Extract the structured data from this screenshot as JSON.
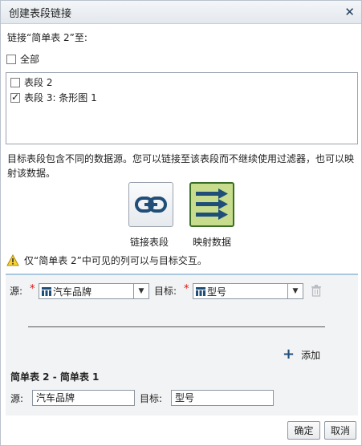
{
  "dialog": {
    "title": "创建表段链接"
  },
  "link_prompt": "链接“简单表 2”至:",
  "select_all": {
    "label": "全部",
    "checked": false
  },
  "sections": [
    {
      "label": "表段 2",
      "checked": false
    },
    {
      "label": "表段 3: 条形图 1",
      "checked": true
    }
  ],
  "note": "目标表段包含不同的数据源。您可以链接至该表段而不继续使用过滤器，也可以映射该数据。",
  "options": {
    "link_label": "链接表段",
    "map_label": "映射数据"
  },
  "warning": "仅“简单表 2”中可见的列可以与目标交互。",
  "mapping": {
    "source_label": "源:",
    "target_label": "目标:",
    "source_value": "汽车品牌",
    "target_value": "型号",
    "add_label": "添加"
  },
  "mapped": {
    "title": "简单表 2 - 简单表 1",
    "source_label": "源:",
    "source_value": "汽车品牌",
    "target_label": "目标:",
    "target_value": "型号"
  },
  "buttons": {
    "ok": "确定",
    "cancel": "取消"
  },
  "colors": {
    "accent": "#1f4e79",
    "map_selected_bg": "#c7dc8c",
    "warning": "#e0b000"
  }
}
